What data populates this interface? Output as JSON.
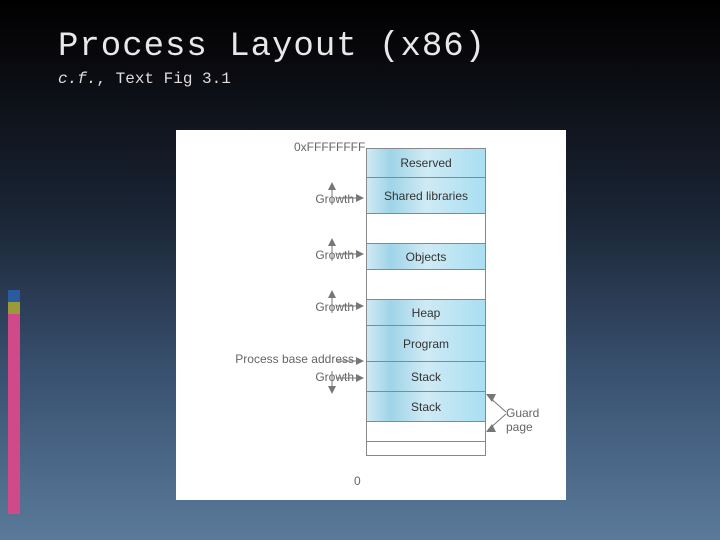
{
  "title": "Process Layout (x86)",
  "subtitle_cf": "c.f.",
  "subtitle_rest": ", Text Fig 3.1",
  "addr_top": "0xFFFFFFFF",
  "addr_bottom": "0",
  "cells": [
    "Reserved",
    "Shared libraries",
    "",
    "Objects",
    "",
    "Heap",
    "Program",
    "Stack",
    "Stack",
    "",
    ""
  ],
  "labels": {
    "growth": "Growth",
    "process_base": "Process base address",
    "guard_page": "Guard page"
  }
}
